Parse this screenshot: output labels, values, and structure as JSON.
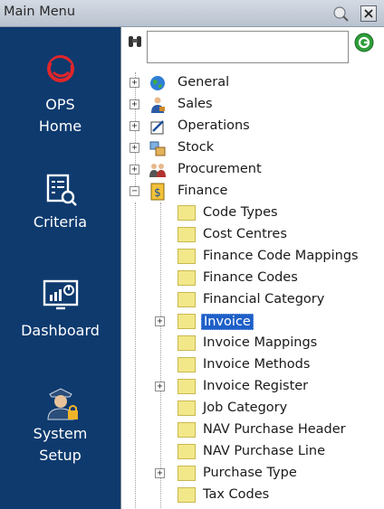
{
  "window": {
    "title": "Main Menu"
  },
  "sidebar": {
    "items": [
      {
        "label_line1": "OPS",
        "label_line2": "Home",
        "icon": "ops-logo-icon"
      },
      {
        "label_line1": "Criteria",
        "icon": "criteria-search-icon"
      },
      {
        "label_line1": "Dashboard",
        "icon": "dashboard-monitor-icon"
      },
      {
        "label_line1": "System",
        "label_line2": "Setup",
        "icon": "user-lock-icon"
      }
    ]
  },
  "search": {
    "value": "",
    "placeholder": ""
  },
  "tree": {
    "roots": [
      {
        "label": "General",
        "icon": "globe-icon",
        "expander": "+"
      },
      {
        "label": "Sales",
        "icon": "sales-person-icon",
        "expander": "+"
      },
      {
        "label": "Operations",
        "icon": "operations-icon",
        "expander": "+"
      },
      {
        "label": "Stock",
        "icon": "stock-boxes-icon",
        "expander": "+"
      },
      {
        "label": "Procurement",
        "icon": "procurement-people-icon",
        "expander": "+"
      },
      {
        "label": "Finance",
        "icon": "finance-dollar-icon",
        "expander": "−"
      }
    ],
    "finance_children": [
      {
        "label": "Code Types",
        "expandable": false
      },
      {
        "label": "Cost Centres",
        "expandable": false
      },
      {
        "label": "Finance Code Mappings",
        "expandable": false
      },
      {
        "label": "Finance Codes",
        "expandable": false
      },
      {
        "label": "Financial Category",
        "expandable": false
      },
      {
        "label": "Invoice",
        "expandable": true,
        "selected": true
      },
      {
        "label": "Invoice Mappings",
        "expandable": false
      },
      {
        "label": "Invoice Methods",
        "expandable": false
      },
      {
        "label": "Invoice Register",
        "expandable": true
      },
      {
        "label": "Job Category",
        "expandable": false
      },
      {
        "label": "NAV Purchase Header",
        "expandable": false
      },
      {
        "label": "NAV Purchase Line",
        "expandable": false
      },
      {
        "label": "Purchase Type",
        "expandable": true
      },
      {
        "label": "Tax Codes",
        "expandable": false
      }
    ]
  },
  "colors": {
    "sidebar_bg": "#0e3a6e",
    "selection": "#1e5fc8",
    "ops_logo": "#e0262b",
    "folder": "#f2e88a"
  }
}
